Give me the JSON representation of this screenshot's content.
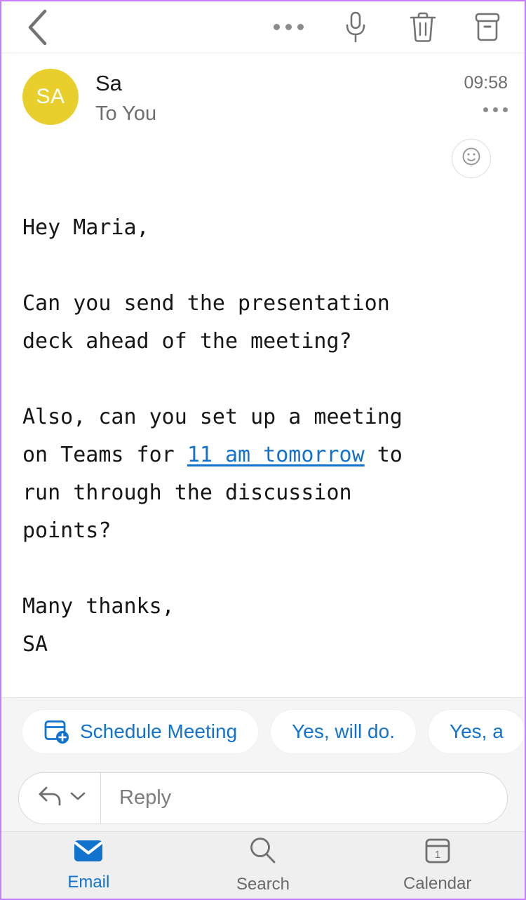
{
  "colors": {
    "accent_blue": "#1273cf",
    "avatar_yellow": "#e9cf2b",
    "icon_gray": "#6e6e6e",
    "window_border": "#c77dff",
    "chip_strip_bg": "#f5f5f5",
    "tabbar_bg": "#efefef"
  },
  "toolbar": {
    "back_label": "Back",
    "more_label": "More options",
    "dictate_label": "Dictate",
    "delete_label": "Delete",
    "archive_label": "Archive",
    "icons": [
      "chevron-left-icon",
      "more-horizontal-icon",
      "microphone-icon",
      "trash-icon",
      "archive-icon"
    ]
  },
  "message": {
    "avatar_initials": "SA",
    "sender_name": "Sa",
    "recipient_line": "To You",
    "time": "09:58",
    "more_label": "Message actions",
    "react_icon": "smiley-face-icon",
    "body": {
      "line_1": "Hey Maria,",
      "line_2": "",
      "line_3": "Can you send the presentation",
      "line_4": "deck ahead of the meeting?",
      "line_5": "",
      "para_2_prefix": "Also, can you set up a meeting\non Teams for ",
      "link_text": "11 am tomorrow",
      "para_2_suffix": " to\nrun through the discussion\npoints?",
      "line_6": "",
      "closing_1": "Many thanks,",
      "closing_2": "SA"
    }
  },
  "suggestions": {
    "chips": [
      {
        "label": "Schedule Meeting",
        "icon": "calendar-add-icon"
      },
      {
        "label": "Yes, will do.",
        "icon": ""
      },
      {
        "label": "Yes, a",
        "icon": ""
      }
    ]
  },
  "reply": {
    "placeholder": "Reply",
    "reply_icon": "reply-arrow-icon",
    "dropdown_icon": "chevron-down-icon"
  },
  "tabbar": {
    "tabs": [
      {
        "label": "Email",
        "icon": "envelope-icon",
        "active": true
      },
      {
        "label": "Search",
        "icon": "search-icon",
        "active": false
      },
      {
        "label": "Calendar",
        "icon": "calendar-icon",
        "active": false
      }
    ],
    "calendar_day": "1"
  }
}
